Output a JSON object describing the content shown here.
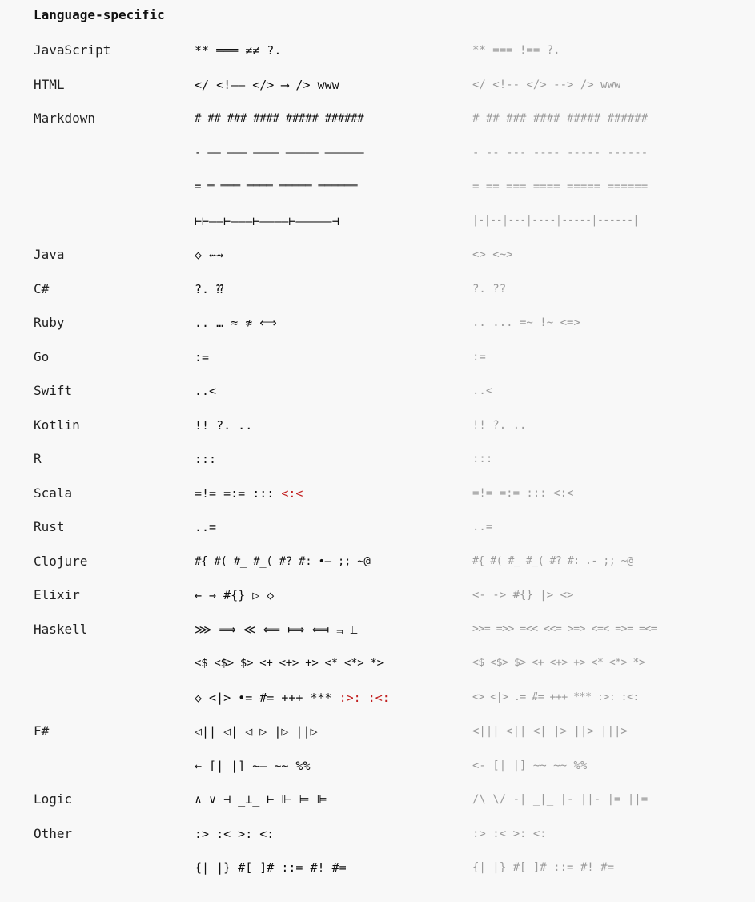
{
  "section_title": "Language-specific",
  "rows": [
    {
      "lang": "JavaScript",
      "ligatures": "** ═══ ≠≠ ?.",
      "plain": "** === !== ?."
    },
    {
      "lang": "HTML",
      "ligatures": "</ <!—— </> ⟶ /> www",
      "plain": "</ <!-- </> --> /> www"
    },
    {
      "lang": "Markdown",
      "ligatures": "# ## ### #### ##### ######",
      "plain": "# ## ### #### ##### ######"
    },
    {
      "lang": "",
      "ligatures": "- –– ——— ———— ————— ——————",
      "plain": "- -- --- ---- ----- ------"
    },
    {
      "lang": "",
      "ligatures": "= ═ ═══ ════ ═════ ══════",
      "plain": "= == === ==== ===== ======"
    },
    {
      "lang": "",
      "ligatures": "⊢⊢——⊢———⊢————⊢—————⊣",
      "plain": "|-|--|---|----|-----|------|"
    },
    {
      "lang": "Java",
      "ligatures": "◇ ⇜⇝",
      "plain": "<> <~>"
    },
    {
      "lang": "C#",
      "ligatures": "?. ⁇",
      "plain": "?. ??"
    },
    {
      "lang": "Ruby",
      "ligatures": ".. … ≈ ≉ ⟺",
      "plain": ".. ... =~ !~ <=>"
    },
    {
      "lang": "Go",
      "ligatures": ":=",
      "plain": ":="
    },
    {
      "lang": "Swift",
      "ligatures": "..<",
      "plain": "..<"
    },
    {
      "lang": "Kotlin",
      "ligatures": "!! ?. ..",
      "plain": "!! ?. .."
    },
    {
      "lang": "R",
      "ligatures": ":::",
      "plain": ":::"
    },
    {
      "lang": "Scala",
      "ligatures": "=!= =:= :::",
      "ligatures_red": " <:<",
      "plain": "=!= =:= ::: <:<"
    },
    {
      "lang": "Rust",
      "ligatures": "..=",
      "plain": "..="
    },
    {
      "lang": "Clojure",
      "ligatures": "#{ #( #_ #_( #? #: •– ;; ~@",
      "plain": "#{ #( #_ #_( #? #: .- ;; ~@"
    },
    {
      "lang": "Elixir",
      "ligatures": "← → #{} ▷ ◇",
      "plain": "<- -> #{} |> <>"
    },
    {
      "lang": "Haskell",
      "ligatures": "⋙ ⟹ ≪ ⟸ ⟾ ⟽ ⫬ ⫫",
      "plain": ">>= =>> =<< <<= >=> <=< =>= =<="
    },
    {
      "lang": "",
      "ligatures": "<$ <$> $> <+ <+> +> <* <*> *>",
      "plain": "<$ <$> $> <+ <+> +> <* <*> *>"
    },
    {
      "lang": "",
      "ligatures": "◇ <|> •= #= +++ *** ",
      "ligatures_red": ":>: :<:",
      "plain": "<> <|> .= #= +++ *** :>: :<:"
    },
    {
      "lang": "F#",
      "ligatures": "◁|| ◁| ◁ ▷ |▷ ||▷",
      "plain": "<||| <|| <| |> ||> |||>"
    },
    {
      "lang": "",
      "ligatures": "← [| |] ~– ~~ %%",
      "plain": "<- [| |] ~~ ~~ %%"
    },
    {
      "lang": "Logic",
      "ligatures": "∧ ∨ ⊣ _⊥_ ⊢ ⊩ ⊨ ⊫",
      "plain": "/\\ \\/ -| _|_ |- ||- |= ||="
    },
    {
      "lang": "Other",
      "ligatures": ":> :< >: <:",
      "plain": ":> :< >: <:"
    },
    {
      "lang": "",
      "ligatures": "{| |} #[ ]# ::= #! #=",
      "plain": "{| |} #[ ]# ::= #! #="
    }
  ]
}
